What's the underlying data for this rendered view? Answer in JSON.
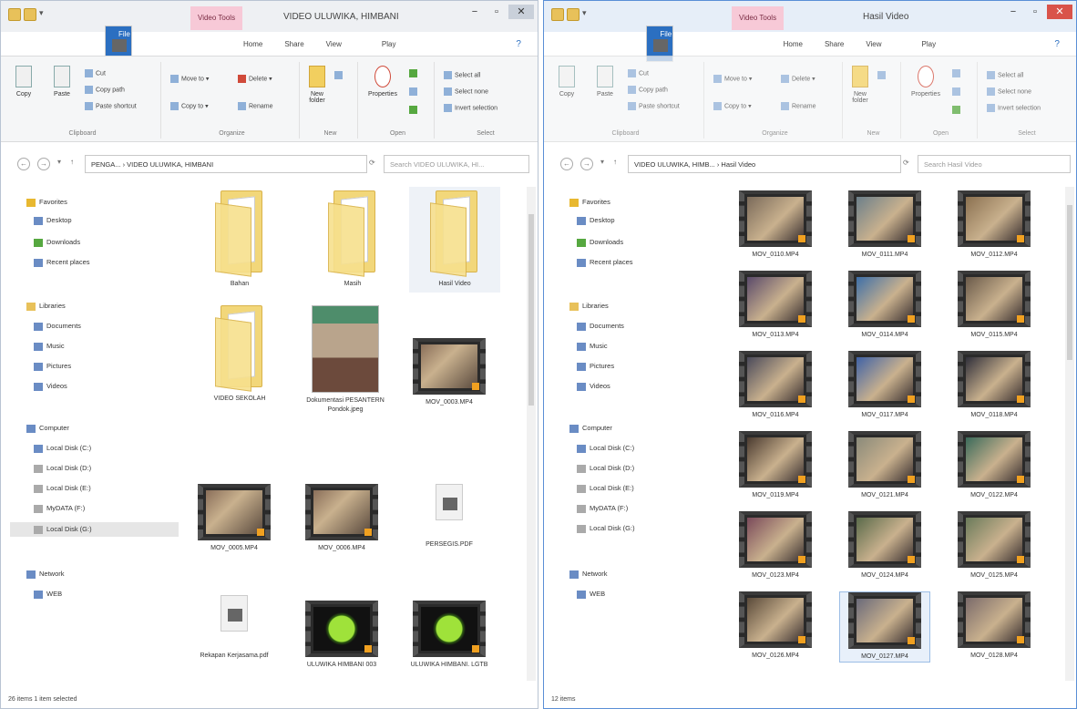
{
  "left": {
    "quick_access": [
      "folder",
      "save",
      "undo"
    ],
    "context_tab": "Video Tools",
    "title": "VIDEO ULUWIKA, HIMBANI",
    "controls": [
      "−",
      "▫",
      "✕"
    ],
    "tabs": [
      "File",
      "Home",
      "Share",
      "View",
      "Play"
    ],
    "help": "?",
    "ribbon": {
      "copy": "Copy",
      "paste": "Paste",
      "cut": "Cut",
      "copy_path": "Copy path",
      "paste_shortcut": "Paste shortcut",
      "clipboard": "Clipboard",
      "move_to": "Move to ▾",
      "copy_to": "Copy to ▾",
      "delete": "Delete ▾",
      "rename": "Rename",
      "organize": "Organize",
      "new_folder": "New folder",
      "new": "New",
      "properties": "Properties",
      "open": "Open",
      "select_all": "Select all",
      "select_none": "Select none",
      "invert_selection": "Invert selection",
      "select": "Select"
    },
    "address": "PENGA... › VIDEO ULUWIKA, HIMBANI",
    "search_placeholder": "Search VIDEO ULUWIKA, HI...",
    "nav": {
      "favorites": "Favorites",
      "desktop": "Desktop",
      "downloads": "Downloads",
      "recent": "Recent places",
      "libraries": "Libraries",
      "documents": "Documents",
      "music": "Music",
      "pictures": "Pictures",
      "videos": "Videos",
      "computer": "Computer",
      "disk_c": "Local Disk (C:)",
      "disk_d": "Local Disk (D:)",
      "disk_e": "Local Disk (E:)",
      "mydata": "MyDATA (F:)",
      "disk_g": "Local Disk (G:)",
      "network": "Network",
      "host": "WEB"
    },
    "files": [
      "Bahan",
      "Masih",
      "Hasil Video",
      "VIDEO SEKOLAH",
      "Dokumentasi PESANTERN Pondok.jpeg",
      "MOV_0003.MP4",
      "MOV_0005.MP4",
      "MOV_0006.MP4",
      "PERSEGIS.PDF",
      "Rekapan Kerjasama.pdf",
      "ULUWIKA HIMBANI 003",
      "ULUWIKA HIMBANI. LGTB"
    ],
    "status": "26 items    1 item selected"
  },
  "right": {
    "quick_access": [
      "folder",
      "save",
      "undo"
    ],
    "context_tab": "Video Tools",
    "title": "Hasil Video",
    "controls": [
      "−",
      "▫",
      "✕"
    ],
    "tabs": [
      "File",
      "Home",
      "Share",
      "View",
      "Play"
    ],
    "help": "?",
    "ribbon": {
      "copy": "Copy",
      "paste": "Paste",
      "cut": "Cut",
      "copy_path": "Copy path",
      "paste_shortcut": "Paste shortcut",
      "clipboard": "Clipboard",
      "move_to": "Move to ▾",
      "copy_to": "Copy to ▾",
      "delete": "Delete ▾",
      "rename": "Rename",
      "organize": "Organize",
      "new_folder": "New folder",
      "new": "New",
      "properties": "Properties",
      "open": "Open",
      "select_all": "Select all",
      "select_none": "Select none",
      "invert_selection": "Invert selection",
      "select": "Select"
    },
    "address": "VIDEO ULUWIKA, HIMB... › Hasil Video",
    "search_placeholder": "Search Hasil Video",
    "nav": {
      "favorites": "Favorites",
      "desktop": "Desktop",
      "downloads": "Downloads",
      "recent": "Recent places",
      "libraries": "Libraries",
      "documents": "Documents",
      "music": "Music",
      "pictures": "Pictures",
      "videos": "Videos",
      "computer": "Computer",
      "disk_c": "Local Disk (C:)",
      "disk_d": "Local Disk (D:)",
      "disk_e": "Local Disk (E:)",
      "mydata": "MyDATA (F:)",
      "disk_g": "Local Disk (G:)",
      "network": "Network",
      "host": "WEB"
    },
    "files": [
      "MOV_0110.MP4",
      "MOV_0111.MP4",
      "MOV_0112.MP4",
      "MOV_0113.MP4",
      "MOV_0114.MP4",
      "MOV_0115.MP4",
      "MOV_0116.MP4",
      "MOV_0117.MP4",
      "MOV_0118.MP4",
      "MOV_0119.MP4",
      "MOV_0121.MP4",
      "MOV_0122.MP4",
      "MOV_0123.MP4",
      "MOV_0124.MP4",
      "MOV_0125.MP4",
      "MOV_0126.MP4",
      "MOV_0127.MP4",
      "MOV_0128.MP4"
    ],
    "status": "12 items"
  }
}
